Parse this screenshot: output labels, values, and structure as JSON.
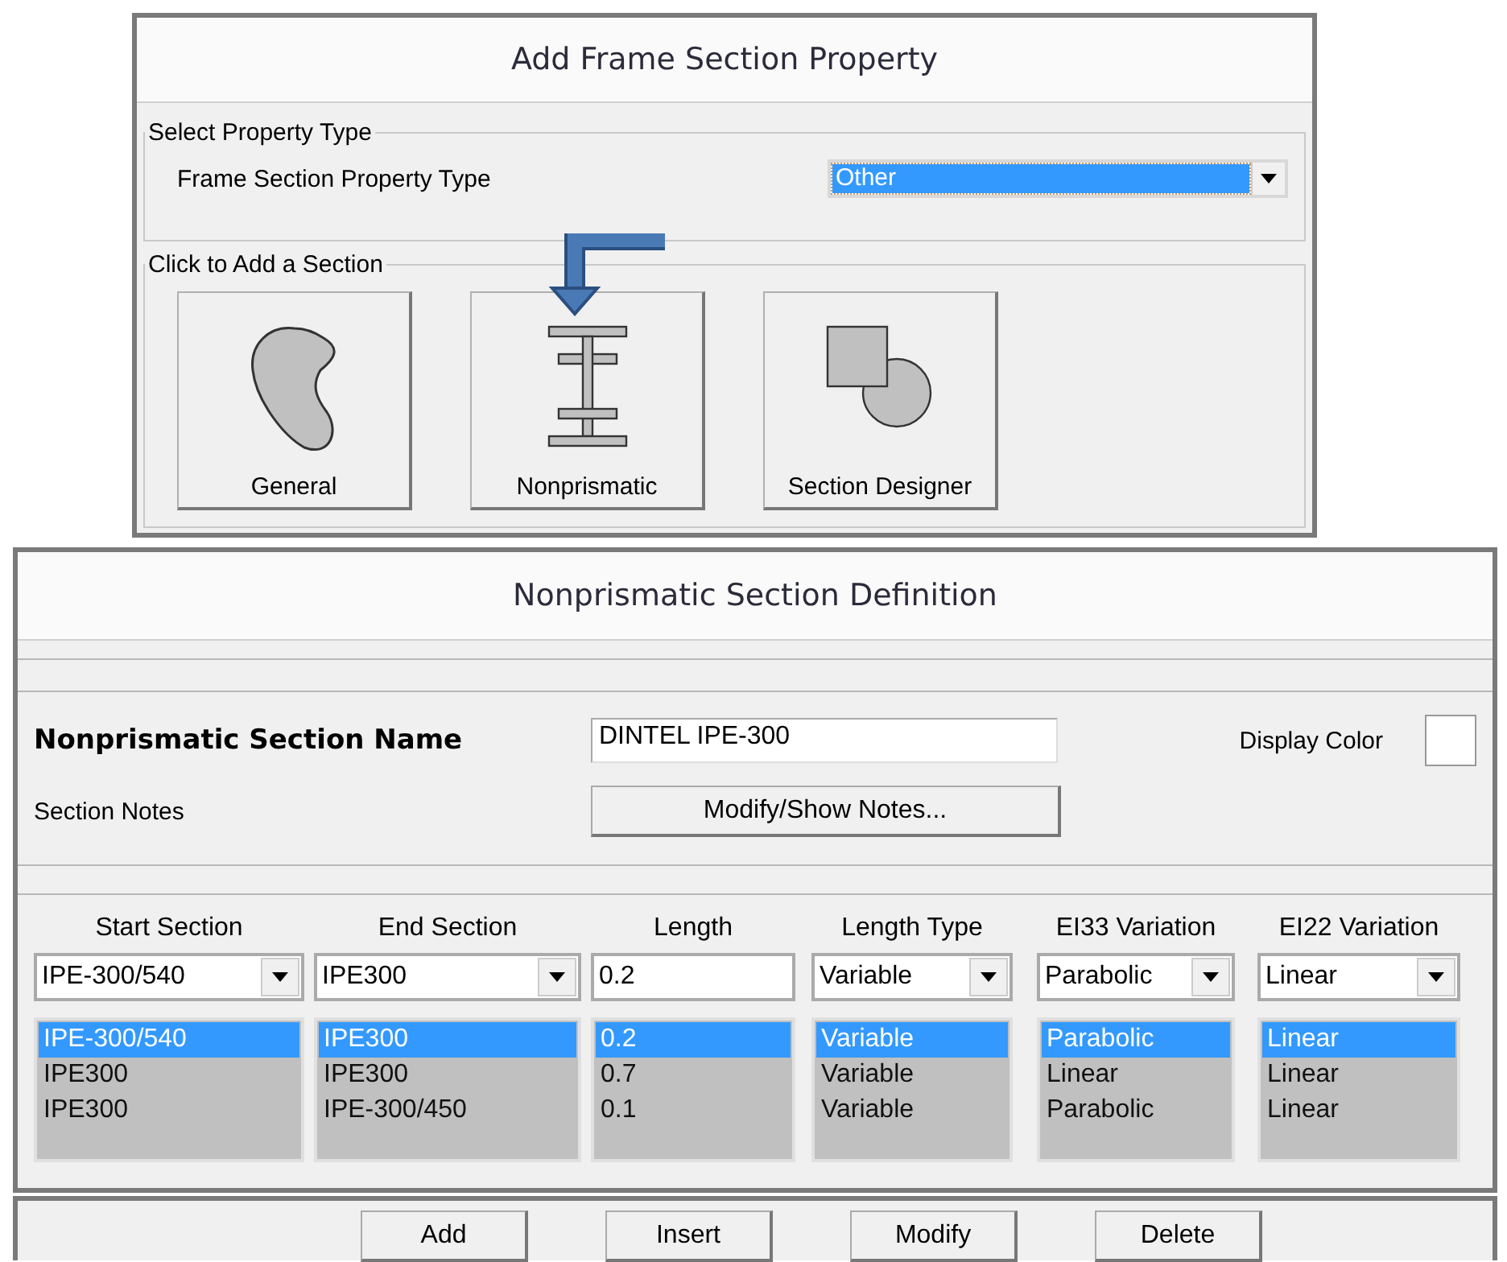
{
  "add_frame_section": {
    "title": "Add Frame Section Property",
    "property_group": {
      "label": "Select Property Type",
      "field_label": "Frame Section Property Type",
      "dropdown_value": "Other"
    },
    "add_group": {
      "label": "Click to Add a Section",
      "buttons": [
        {
          "label": "General",
          "kind": "general"
        },
        {
          "label": "Nonprismatic",
          "kind": "nonprismatic"
        },
        {
          "label": "Section Designer",
          "kind": "designer"
        }
      ]
    }
  },
  "nonprismatic_definition": {
    "title": "Nonprismatic Section Definition",
    "name_label": "Nonprismatic Section Name",
    "name_value": "DINTEL IPE-300",
    "display_color_label": "Display Color",
    "notes_label": "Section Notes",
    "notes_button": "Modify/Show Notes...",
    "columns": [
      {
        "header": "Start Section",
        "kind": "combo",
        "value": "IPE-300/540"
      },
      {
        "header": "End Section",
        "kind": "combo",
        "value": "IPE300"
      },
      {
        "header": "Length",
        "kind": "text",
        "value": "0.2"
      },
      {
        "header": "Length Type",
        "kind": "combo",
        "value": "Variable"
      },
      {
        "header": "EI33 Variation",
        "kind": "combo",
        "value": "Parabolic"
      },
      {
        "header": "EI22 Variation",
        "kind": "combo",
        "value": "Linear"
      }
    ],
    "rows": [
      {
        "selected": true,
        "cells": [
          "IPE-300/540",
          "IPE300",
          "0.2",
          "Variable",
          "Parabolic",
          "Linear"
        ]
      },
      {
        "selected": false,
        "cells": [
          "IPE300",
          "IPE300",
          "0.7",
          "Variable",
          "Linear",
          "Linear"
        ]
      },
      {
        "selected": false,
        "cells": [
          "IPE300",
          "IPE-300/450",
          "0.1",
          "Variable",
          "Parabolic",
          "Linear"
        ]
      }
    ]
  },
  "buttons": [
    "Add",
    "Insert",
    "Modify",
    "Delete"
  ]
}
